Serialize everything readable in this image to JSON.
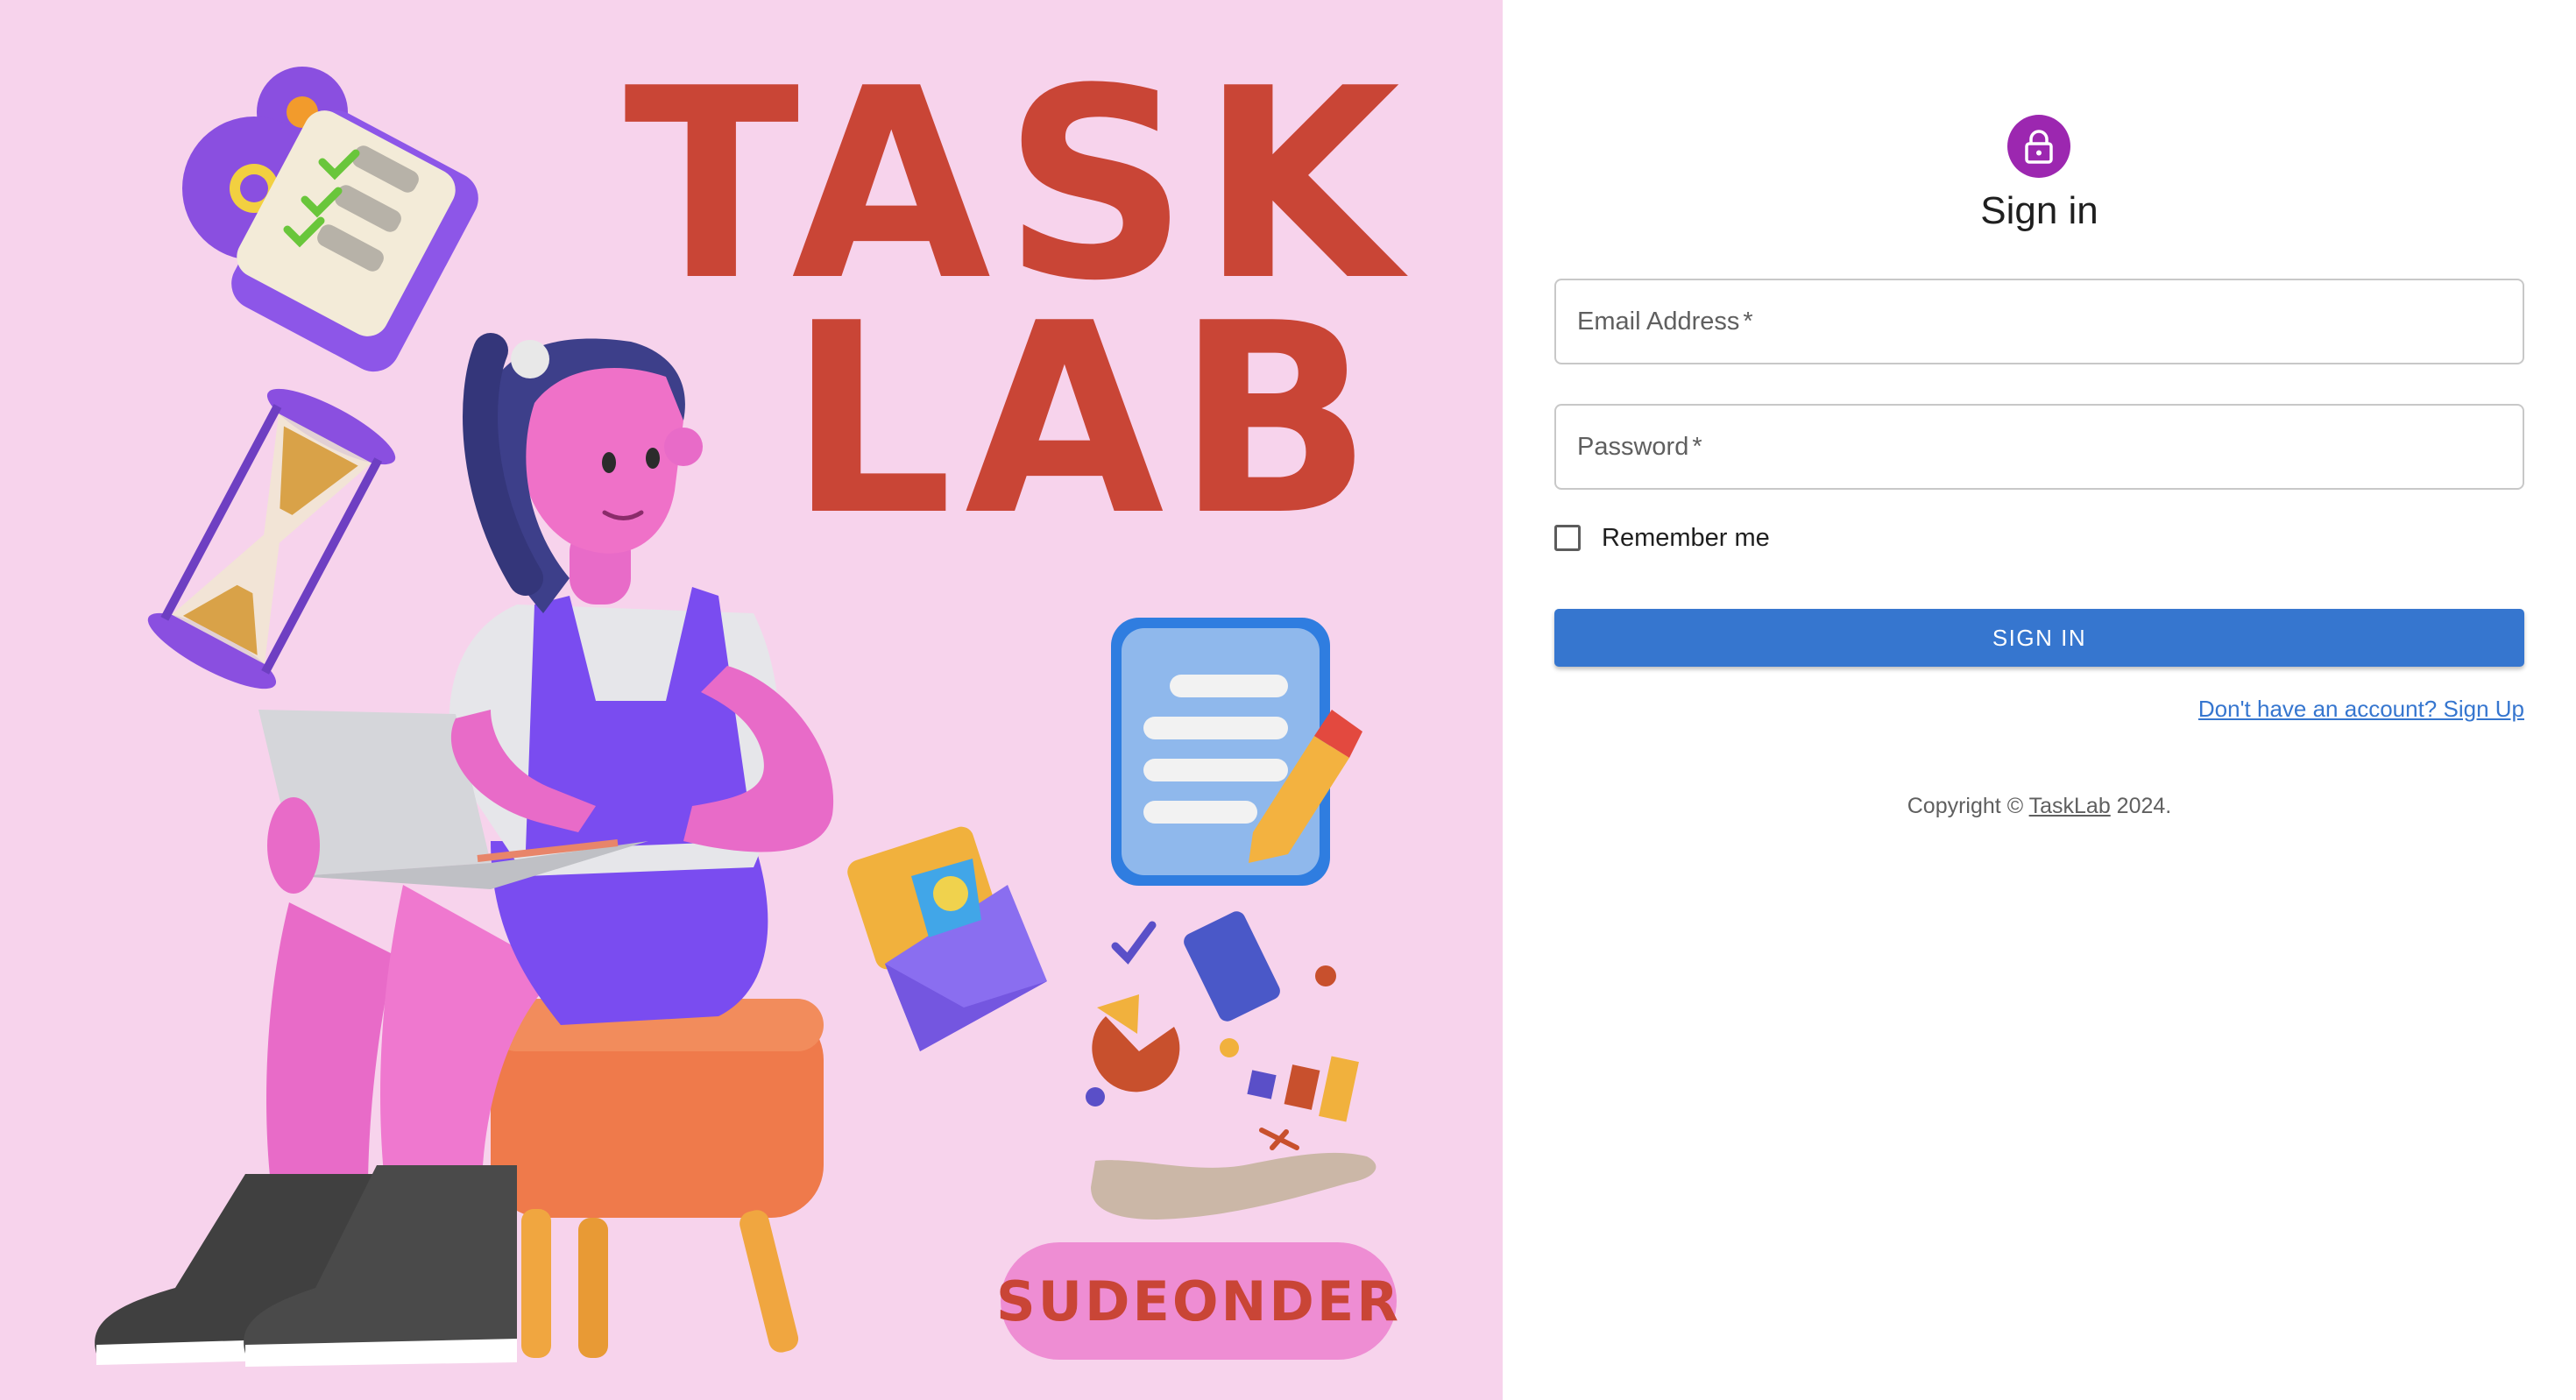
{
  "hero": {
    "title_line1": "TASK",
    "title_line2": "LAB",
    "badge": "SUDEONDER",
    "colors": {
      "background": "#f7d3ec",
      "title": "#c94536",
      "badge": "#ee8dd3"
    },
    "illustrations": [
      "checklist-gears-icon",
      "hourglass-icon",
      "person-with-laptop",
      "megaphone-envelope-icon",
      "clipboard-pencil-icon",
      "floating-charts-hand-icon"
    ]
  },
  "signin": {
    "avatar_icon": "lock-icon",
    "title": "Sign in",
    "email_label": "Email Address",
    "password_label": "Password",
    "required_mark": "*",
    "remember_label": "Remember me",
    "remember_checked": false,
    "submit_label": "Sign In",
    "signup_link": "Don't have an account? Sign Up",
    "copyright_prefix": "Copyright © ",
    "copyright_link": "TaskLab",
    "copyright_suffix": " 2024.",
    "colors": {
      "avatar": "#9c27b0",
      "primary": "#3676cf"
    }
  }
}
